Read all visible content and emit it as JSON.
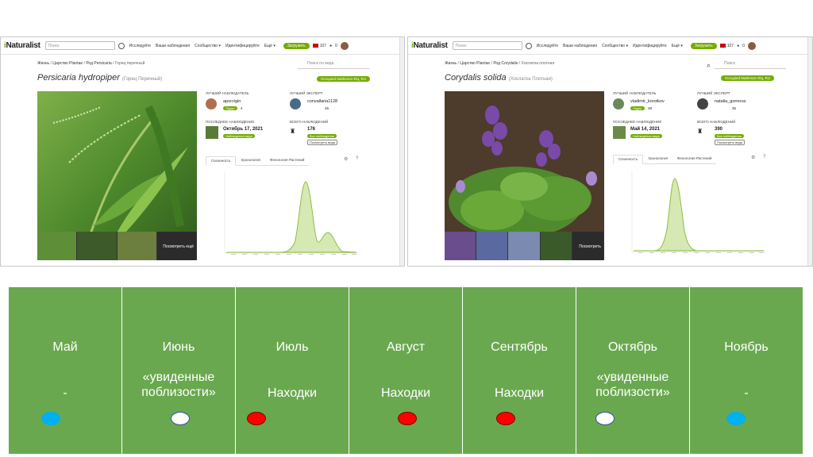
{
  "colors": {
    "inat_green": "#74ac00",
    "panel_green": "#6aa84f",
    "dot_blue": "#00b0f0",
    "dot_red": "#ff0000",
    "dot_white": "#ffffff",
    "dot_white_border": "#2f5597"
  },
  "left": {
    "logo": "iNaturalist",
    "search_placeholder": "Поиск",
    "nav": [
      "Исследуйте",
      "Ваши наблюдения",
      "Сообщество ▾",
      "Идентифицируйте",
      "Ещё ▾"
    ],
    "upload_label": "Загрузить",
    "mail_count": "107",
    "chat_count": "0",
    "breadcrumb": [
      "Жизнь",
      "Царство Plantae",
      "Род Persicaria",
      "Горец перечный"
    ],
    "title_sci": "Persicaria hydropiper",
    "title_common": "(Горец Перечный)",
    "place_search": "Поиск по вида",
    "place_chip": "Occupied Matheson ФЦ, RU",
    "view_more": "Посмотреть ещё",
    "top_observer_label": "Лучший наблюдатель",
    "top_observer": "apocrigin",
    "top_observer_badge": "Лидер",
    "top_observer_count": "4",
    "top_identifier_label": "Лучший эксперт",
    "top_identifier": "convallaria1128",
    "top_identifier_count": "45",
    "last_obs_label": "Последнее наблюдение",
    "last_obs_date": "Октябрь 17, 2021",
    "last_obs_link": "Наблюдения вида",
    "total_label": "Всего наблюдений",
    "total_count": "176",
    "total_link": "Все наблюдения",
    "total_link2": "Посмотреть вида",
    "tabs": [
      "Сезонность",
      "Хронология",
      "Фенология Растений"
    ]
  },
  "right": {
    "logo": "iNaturalist",
    "search_placeholder": "Поиск",
    "nav": [
      "Исследуйте",
      "Ваши наблюдения",
      "Сообщество ▾",
      "Идентифицируйте",
      "Ещё ▾"
    ],
    "upload_label": "Загрузить",
    "mail_count": "107",
    "chat_count": "0",
    "breadcrumb": [
      "Жизнь",
      "Царство Plantae",
      "Род Corydalis",
      "Хохлатка плотная"
    ],
    "title_sci": "Corydalis solida",
    "title_common": "(Хохлатка Плотная)",
    "place_search": "Поиск",
    "place_chip": "Occupied Matheson ФЦ, RU",
    "view_more": "Посмотреть",
    "top_observer_label": "Лучший наблюдатель",
    "top_observer": "vladimir_korotkov",
    "top_observer_badge": "Лидер",
    "top_observer_count": "28",
    "top_identifier_label": "Лучший эксперт",
    "top_identifier": "natalia_gornova",
    "top_identifier_count": "35",
    "last_obs_label": "Последнее наблюдение",
    "last_obs_date": "Май 14, 2021",
    "last_obs_link": "Наблюдения вида",
    "total_label": "Всего наблюдений",
    "total_count": "390",
    "total_link": "Все наблюдения",
    "total_link2": "Посмотреть вида",
    "tabs": [
      "Сезонность",
      "Хронология",
      "Фенология Растений"
    ]
  },
  "months": [
    {
      "name": "Май",
      "status": "-",
      "dot": "blue"
    },
    {
      "name": "Июнь",
      "status": "«увиденные поблизости»",
      "dot": "white"
    },
    {
      "name": "Июль",
      "status": "Находки",
      "dot": "red"
    },
    {
      "name": "Август",
      "status": "Находки",
      "dot": "red"
    },
    {
      "name": "Сентябрь",
      "status": "Находки",
      "dot": "red"
    },
    {
      "name": "Октябрь",
      "status": "«увиденные поблизости»",
      "dot": "white"
    },
    {
      "name": "Ноябрь",
      "status": "-",
      "dot": "blue"
    }
  ]
}
